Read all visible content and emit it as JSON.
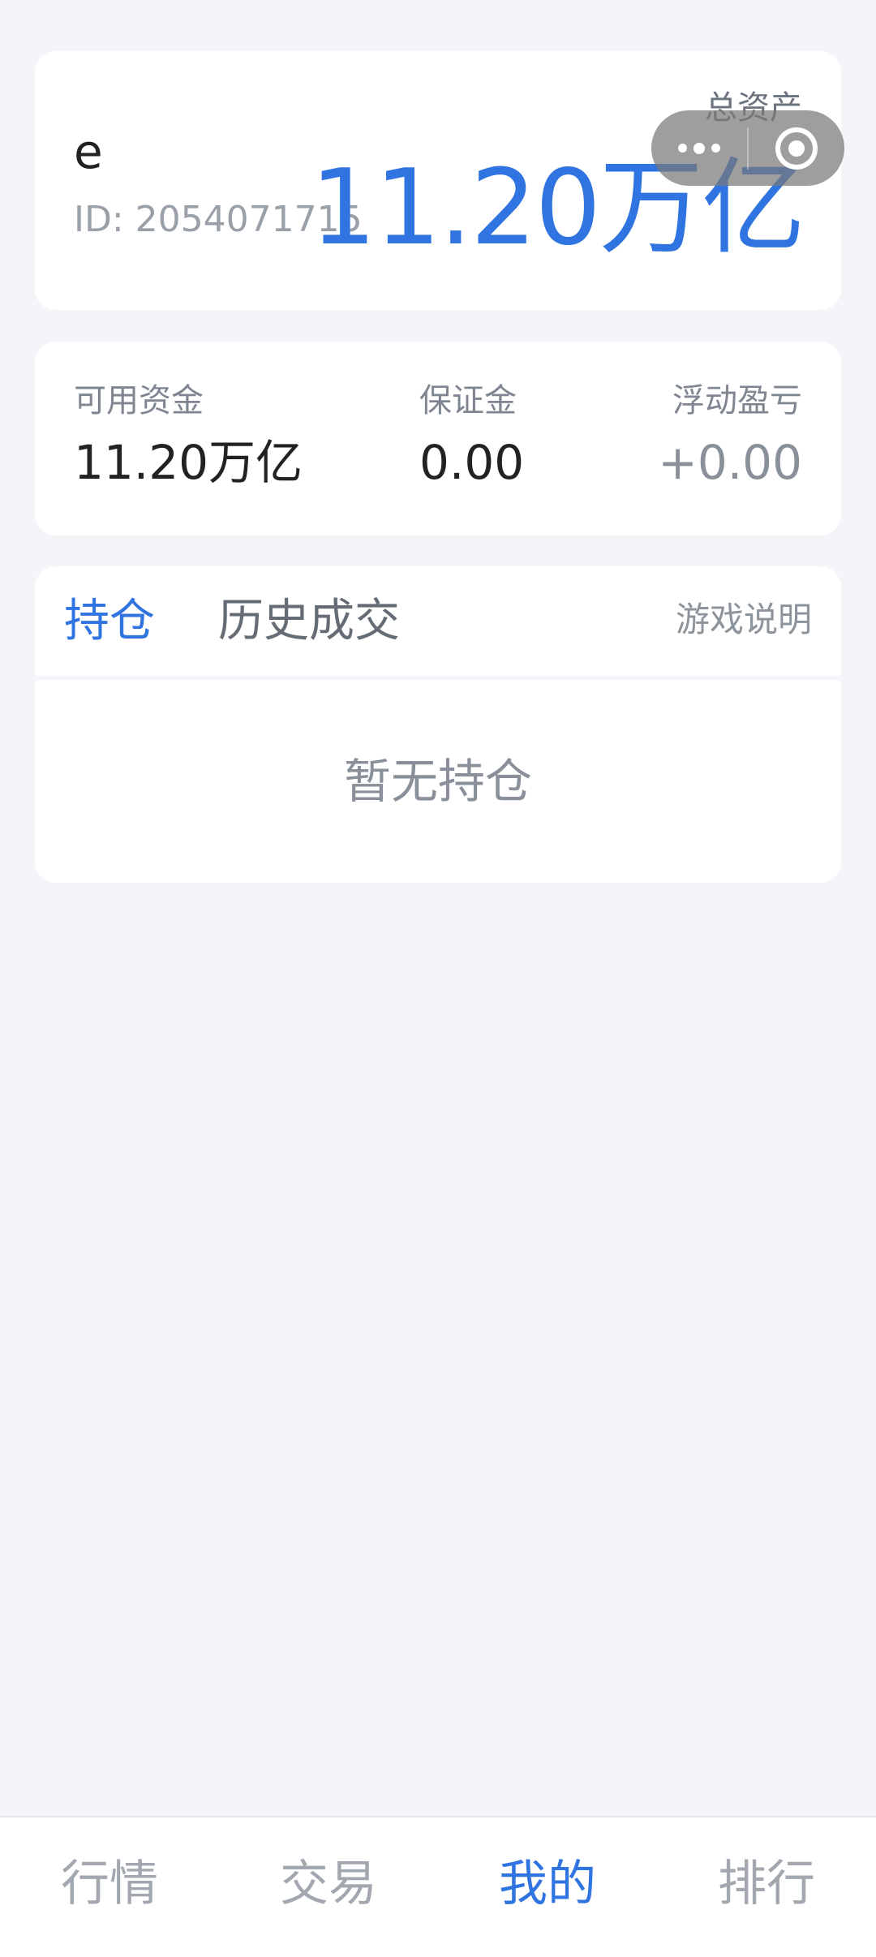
{
  "account": {
    "username": "e",
    "id_text": "ID: 2054071715",
    "total_label": "总资产",
    "total_value": "11.20万亿"
  },
  "balances": [
    {
      "label": "可用资金",
      "value": "11.20万亿"
    },
    {
      "label": "保证金",
      "value": "0.00"
    },
    {
      "label": "浮动盈亏",
      "value": "+0.00"
    }
  ],
  "tabs": {
    "positions": "持仓",
    "history": "历史成交",
    "game_help": "游戏说明"
  },
  "empty_state": "暂无持仓",
  "bottom_nav": [
    {
      "label": "行情",
      "active": false
    },
    {
      "label": "交易",
      "active": false
    },
    {
      "label": "我的",
      "active": true
    },
    {
      "label": "排行",
      "active": false
    }
  ],
  "colors": {
    "accent": "#2f74e0",
    "background": "#f3f5f9",
    "card": "#ffffff"
  },
  "icons": [
    "more-icon",
    "close-target-icon"
  ]
}
